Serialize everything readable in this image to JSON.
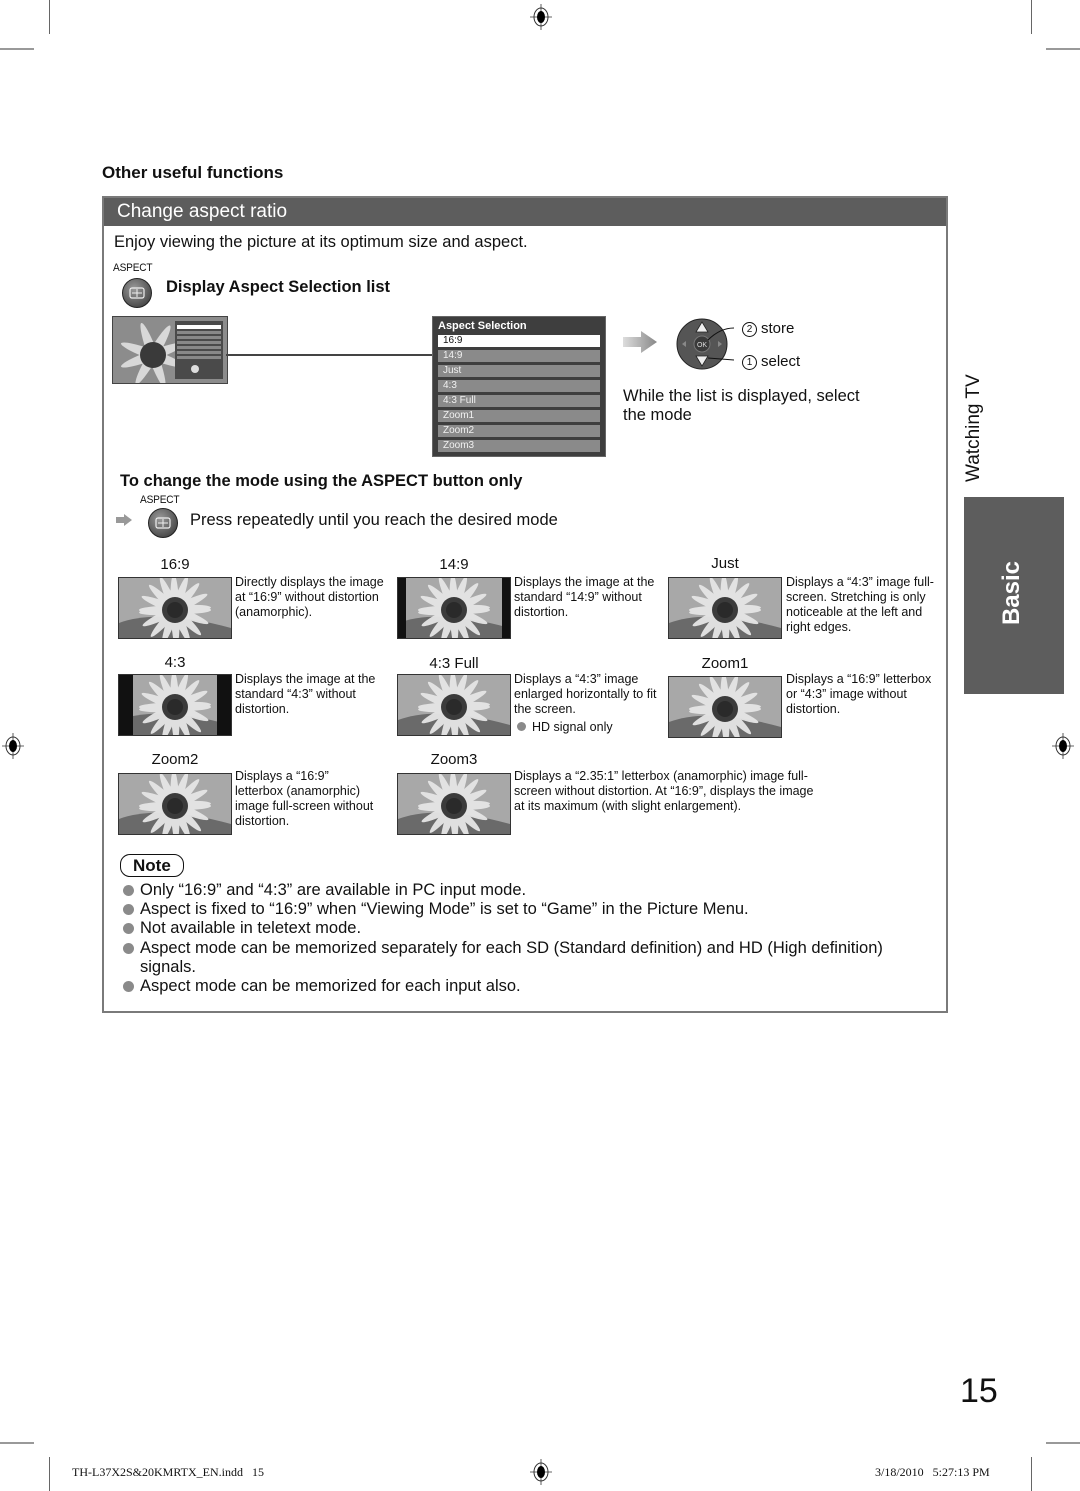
{
  "section_heading": "Other useful functions",
  "panel": {
    "title": "Change aspect ratio",
    "intro": "Enjoy viewing the picture at its optimum size and aspect.",
    "aspect_button_label": "ASPECT",
    "step1_heading": "Display Aspect Selection list",
    "menu": {
      "title": "Aspect Selection",
      "items": [
        "16:9",
        "14:9",
        "Just",
        "4:3",
        "4:3 Full",
        "Zoom1",
        "Zoom2",
        "Zoom3"
      ],
      "selected_index": 0
    },
    "remote": {
      "ok_label": "OK",
      "store_number": "2",
      "store_label": "store",
      "select_number": "1",
      "select_label": "select",
      "instruction": "While the list is displayed, select the mode"
    },
    "step2_heading": "To change the mode using the ASPECT button only",
    "step2_button_label": "ASPECT",
    "step2_text": "Press repeatedly until you reach the desired mode",
    "modes": [
      {
        "name": "16:9",
        "description": "Directly displays the image at “16:9” without distortion (anamorphic)."
      },
      {
        "name": "14:9",
        "description": "Displays the image at the standard “14:9” without distortion."
      },
      {
        "name": "Just",
        "description": "Displays a “4:3” image full-screen. Stretching is only noticeable at the left and right edges."
      },
      {
        "name": "4:3",
        "description": "Displays the image at the standard “4:3” without distortion."
      },
      {
        "name": "4:3 Full",
        "description": "Displays a “4:3” image enlarged horizontally to fit the screen.",
        "note": "HD signal only"
      },
      {
        "name": "Zoom1",
        "description": "Displays a “16:9” letterbox or “4:3” image without distortion."
      },
      {
        "name": "Zoom2",
        "description": "Displays a “16:9” letterbox (anamorphic) image full-screen without distortion."
      },
      {
        "name": "Zoom3",
        "description": "Displays a “2.35:1” letterbox (anamorphic) image full-screen without distortion. At “16:9”, displays the image at its maximum (with slight enlargement)."
      }
    ],
    "note_label": "Note",
    "notes": [
      "Only “16:9” and “4:3” are available in PC input mode.",
      "Aspect is fixed to “16:9” when “Viewing Mode” is set to “Game” in the Picture Menu.",
      "Not available in teletext mode.",
      "Aspect mode can be memorized separately for each SD (Standard definition) and HD (High definition) signals.",
      "Aspect mode can be memorized for each input also."
    ]
  },
  "side_tabs": {
    "chapter": "Watching TV",
    "section": "Basic"
  },
  "page_number": "15",
  "footer": {
    "file": "TH-L37X2S&20KMRTX_EN.indd   15",
    "timestamp": "3/18/2010   5:27:13 PM"
  },
  "colors": {
    "header_bar": "#5d5d5d",
    "panel_border": "#7a7a7a",
    "bullet": "#8a8a8a"
  }
}
